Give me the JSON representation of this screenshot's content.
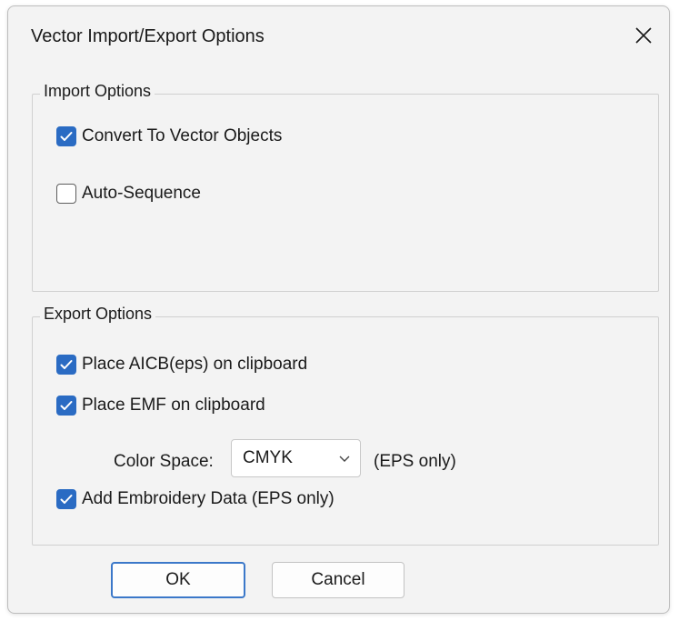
{
  "dialog": {
    "title": "Vector Import/Export Options",
    "close_icon": "close-icon"
  },
  "import_options": {
    "label": "Import Options",
    "convert_to_vector": {
      "label": "Convert To Vector Objects",
      "checked": true
    },
    "auto_sequence": {
      "label": "Auto-Sequence",
      "checked": false
    }
  },
  "export_options": {
    "label": "Export Options",
    "place_aicb": {
      "label": "Place AICB(eps) on clipboard",
      "checked": true
    },
    "place_emf": {
      "label": "Place EMF on clipboard",
      "checked": true
    },
    "color_space": {
      "label": "Color Space:",
      "value": "CMYK",
      "note": "(EPS only)"
    },
    "add_embroidery": {
      "label": "Add Embroidery Data (EPS only)",
      "checked": true
    }
  },
  "buttons": {
    "ok": "OK",
    "cancel": "Cancel"
  },
  "colors": {
    "accent": "#2a6bc3",
    "dialog_bg": "#f3f3f3"
  }
}
